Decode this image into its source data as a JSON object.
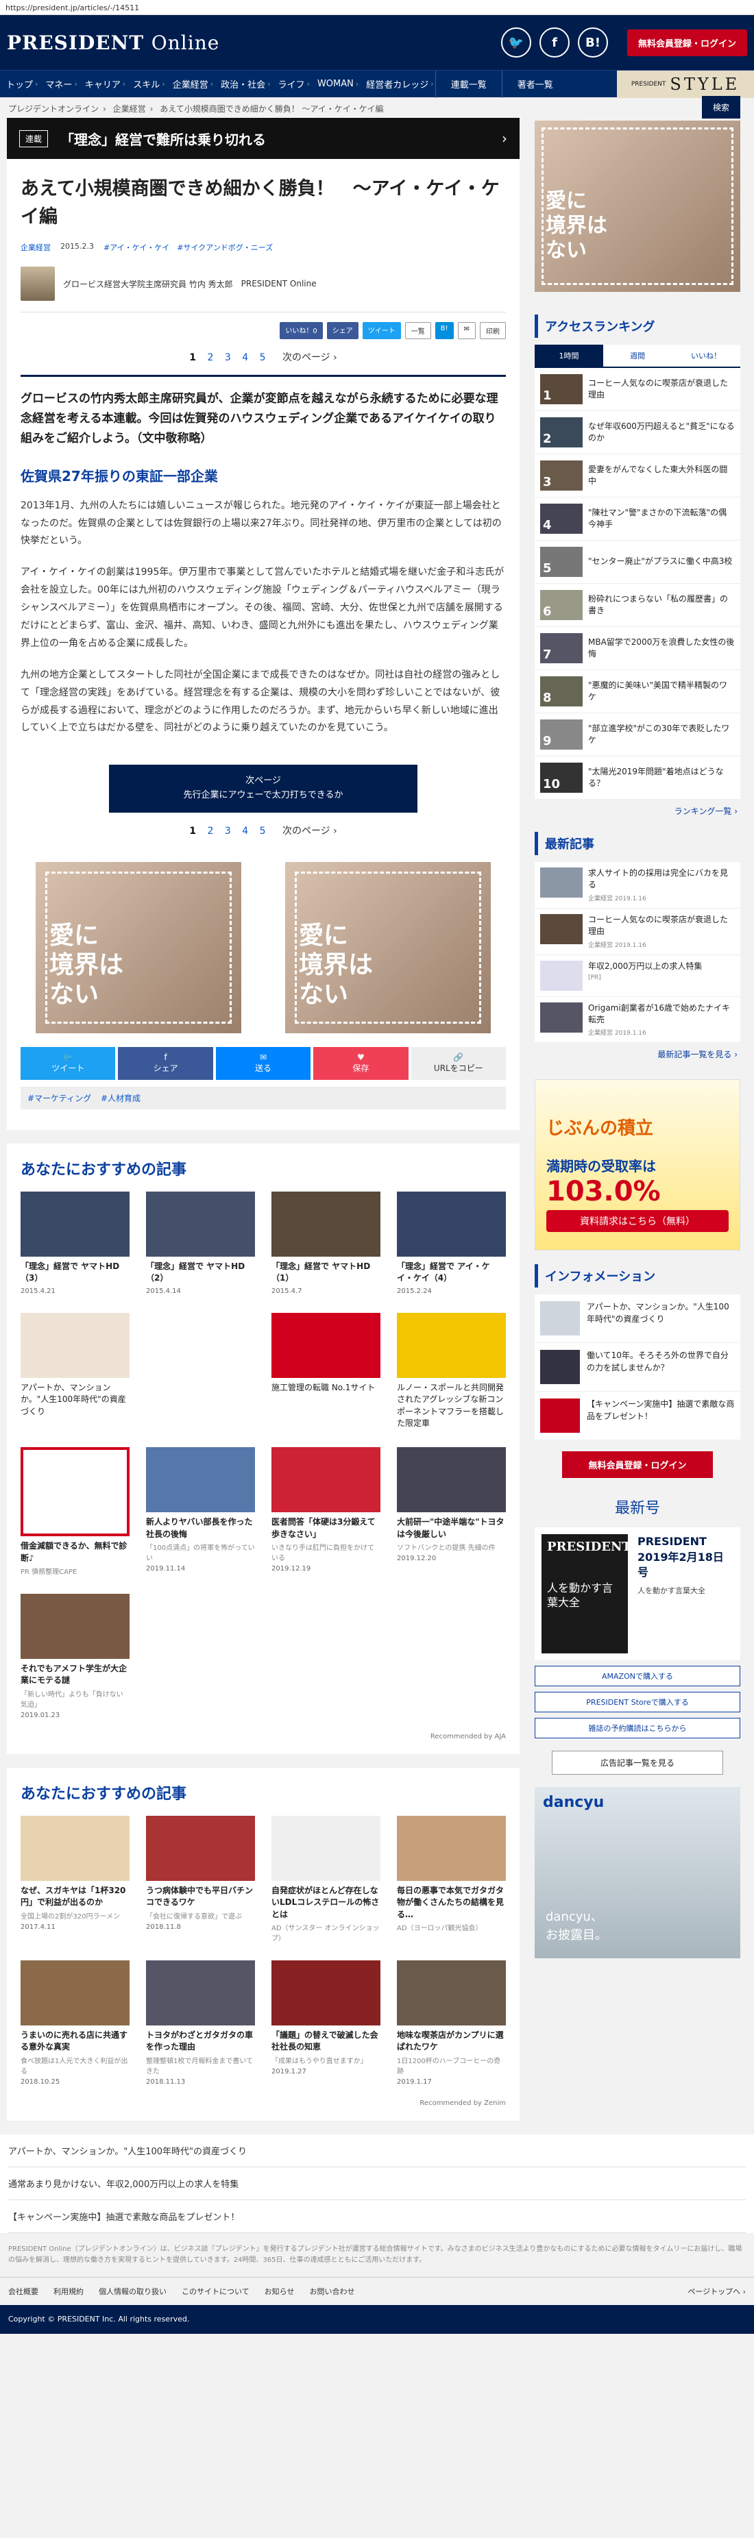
{
  "url": "https://president.jp/articles/-/14511",
  "header": {
    "logo_main": "PRESIDENT",
    "logo_sub": "Online",
    "sns": [
      "twitter",
      "facebook",
      "B!"
    ],
    "register": "無料会員登録・ログイン"
  },
  "nav": {
    "items": [
      "トップ",
      "マネー",
      "キャリア",
      "スキル",
      "企業経営",
      "政治・社会",
      "ライフ",
      "WOMAN",
      "経営者カレッジ"
    ],
    "ext": [
      "連載一覧",
      "著者一覧"
    ],
    "style_small": "PRESIDENT",
    "style_big": "STYLE"
  },
  "breadcrumb": [
    "プレジデントオンライン",
    "企業経営",
    "あえて小規模商圏できめ細かく勝負！ ～アイ・ケイ・ケイ編"
  ],
  "series": {
    "tag": "連載",
    "title": "「理念」経営で難所は乗り切れる"
  },
  "article": {
    "title": "あえて小規模商圏できめ細かく勝負！　～アイ・ケイ・ケイ編",
    "category": "企業経営",
    "date": "2015.2.3",
    "tags_meta": "#アイ・ケイ・ケイ　#サイクアンドボグ・ニーズ",
    "author": "グロービス経営大学院主席研究員 竹内 秀太郎",
    "source": "PRESIDENT Online",
    "share": [
      "いいね！0",
      "シェア",
      "ツイート",
      "一覧",
      "B!",
      "✉",
      "印刷"
    ],
    "pages": [
      "1",
      "2",
      "3",
      "4",
      "5"
    ],
    "next_label": "次のページ ›",
    "lead": "グロービスの竹内秀太郎主席研究員が、企業が変節点を越えながら永続するために必要な理念経営を考える本連載。今回は佐賀発のハウスウェディング企業であるアイケイケイの取り組みをご紹介しよう。（文中敬称略）",
    "h2": "佐賀県27年振りの東証一部企業",
    "p1": "2013年1月、九州の人たちには嬉しいニュースが報じられた。地元発のアイ・ケイ・ケイが東証一部上場会社となったのだ。佐賀県の企業としては佐賀銀行の上場以来27年ぶり。同社発祥の地、伊万里市の企業としては初の快挙だという。",
    "p2": "アイ・ケイ・ケイの創業は1995年。伊万里市で事業として営んでいたホテルと結婚式場を継いだ金子和斗志氏が会社を設立した。00年には九州初のハウスウェディング施設「ウェディング＆パーティハウスベルアミー（現ラシャンスベルアミー）」を佐賀県鳥栖市にオープン。その後、福岡、宮崎、大分、佐世保と九州で店舗を展開するだけにとどまらず、富山、金沢、福井、高知、いわき、盛岡と九州外にも進出を果たし、ハウスウェディング業界上位の一角を占める企業に成長した。",
    "p3": "九州の地方企業としてスタートした同社が全国企業にまで成長できたのはなぜか。同社は自社の経営の強みとして「理念経営の実践」をあげている。経営理念を有する企業は、規模の大小を問わず珍しいことではないが、彼らが成長する過程において、理念がどのように作用したのだろうか。まず、地元からいち早く新しい地域に進出していく上で立ちはだかる壁を、同社がどのように乗り越えていたのかを見ていこう。",
    "nextpage_label": "次ページ",
    "nextpage_sub": "先行企業にアウェーで太刀打ちできるか",
    "ad_text": "愛に\n境界は\nない",
    "share_bar": [
      "ツイート",
      "シェア",
      "送る",
      "保存",
      "URLをコピー"
    ],
    "tags": [
      "#マーケティング",
      "#人材育成"
    ]
  },
  "rec1": {
    "title": "あなたにおすすめの記事",
    "items": [
      {
        "t": "「理念」経営で ヤマトHD（3）",
        "d": "2015.4.21",
        "s": ""
      },
      {
        "t": "「理念」経営で ヤマトHD（2）",
        "d": "2015.4.14",
        "s": ""
      },
      {
        "t": "「理念」経営で ヤマトHD（1）",
        "d": "2015.4.7",
        "s": ""
      },
      {
        "t": "「理念」経営で アイ・ケイ・ケイ（4）",
        "d": "2015.2.24",
        "s": ""
      },
      {
        "t": "アパートか、マンションか。\"人生100年時代\"の資産づくり",
        "d": "",
        "s": ""
      },
      {
        "t": "",
        "d": "",
        "s": ""
      },
      {
        "t": "施工管理の転職 No.1サイト",
        "d": "",
        "s": ""
      },
      {
        "t": "ルノー・スポールと共同開発されたアグレッシブな新コンポーネントマフラーを搭載した限定車",
        "d": "",
        "s": ""
      },
      {
        "t": "借金減額できるか、無料で診断♪",
        "d": "",
        "s": "PR 債務整理CAPE"
      },
      {
        "t": "新人よりヤバい部長を作った社長の後悔",
        "d": "2019.11.14",
        "s": "「100点満点」の将軍を怖がっていい"
      },
      {
        "t": "医者問答「体硬は3分鍛えて歩きなさい」",
        "d": "2019.12.19",
        "s": "いきなり手は肛門に負担をかけている"
      },
      {
        "t": "大前研一\"中途半端な\"トヨタは今後厳しい",
        "d": "2019.12.20",
        "s": "ソフトバンクとの提携 先細の件"
      },
      {
        "t": "それでもアメフト学生が大企業にモテる謎",
        "d": "2019.01.23",
        "s": "「新しい時代」よりも「負けない気迫」"
      }
    ],
    "footer": "Recommended by AJA"
  },
  "rec2": {
    "title": "あなたにおすすめの記事",
    "items": [
      {
        "t": "なぜ、スガキヤは「1杯320円」で利益が出るのか",
        "s": "全国上場の2割が320円ラーメン",
        "d": "2017.4.11"
      },
      {
        "t": "うつ病体験中でも平日バチンコできるワケ",
        "s": "「会社に復帰する意欲」で遊ぶ",
        "d": "2018.11.8"
      },
      {
        "t": "自発症状がほとんど存在しないLDLコレステロールの怖さとは",
        "s": "AD（サンスター オンラインショップ）",
        "d": ""
      },
      {
        "t": "毎日の悪事で本気でガタガタ物が働くさんたちの結構を見る…",
        "s": "AD（ヨーロッパ観光協会）",
        "d": ""
      },
      {
        "t": "うまいのに売れる店に共通する意外な真実",
        "s": "食べ放題は1人元で大きく利益が出る",
        "d": "2018.10.25"
      },
      {
        "t": "トヨタがわざとガタガタの車を作った理由",
        "s": "整理整頓1枚で月報料金まで書いてきた",
        "d": "2018.11.13"
      },
      {
        "t": "「議題」の替えで破滅した会社社長の知恵",
        "s": "「成果はもうやり直せますか」",
        "d": "2019.1.27"
      },
      {
        "t": "地味な喫茶店がカンプリに選ばれたワケ",
        "s": "1日1200杯のハーブコーヒーの奇跡",
        "d": "2019.1.17"
      }
    ],
    "footer": "Recommended by Zenim"
  },
  "sidebar": {
    "ad_text": "愛に\n境界は\nない",
    "search_label": "検索",
    "ranking_title": "アクセスランキング",
    "tabs": [
      "1時間",
      "週間",
      "いいね！"
    ],
    "ranking": [
      "コーヒー人気なのに喫茶店が衰退した理由",
      "なぜ年収600万円超えると\"貧乏\"になるのか",
      "愛妻をがんでなくした東大外科医の闘中",
      "\"陳社マン\"警\"まさかの下流転落\"の偶今神手",
      "\"センター廃止\"がプラスに働く中高3校",
      "粉砕れにつまらない「私の履歴書」の書き",
      "MBA留学で2000万を浪費した女性の後悔",
      "\"悪魔的に美味い\"美国で精半精製のワケ",
      "\"部立進学校\"がこの30年で表貶したワケ",
      "\"太陽光2019年問題\"着地点はどうなる？"
    ],
    "ranking_more": "ランキング一覧 ›",
    "latest_title": "最新記事",
    "latest": [
      {
        "t": "求人サイト的の採用は完全にバカを見る",
        "d": "企業経営 2019.1.16"
      },
      {
        "t": "コーヒー人気なのに喫茶店が衰退した理由",
        "d": "企業経営 2019.1.16"
      },
      {
        "t": "年収2,000万円以上の求人特集",
        "d": "[PR]"
      },
      {
        "t": "Origami創業者が16歳で始めたナイキ転売",
        "d": "企業経営 2019.1.16"
      }
    ],
    "latest_more": "最新記事一覧を見る ›",
    "bank_ad": {
      "l1": "じぶんの積立",
      "l2": "満期時の受取率は",
      "l3": "103.0%",
      "l4": "資料請求はこちら（無料）"
    },
    "info_title": "インフォメーション",
    "info": [
      "アパートか、マンションか。\"人生100年時代\"の資産づくり",
      "働いて10年。そろそろ外の世界で自分の力を試しませんか？",
      "【キャンペーン実施中】抽選で素敵な商品をプレゼント！"
    ],
    "register": "無料会員登録・ログイン",
    "issue_title": "最新号",
    "issue_cover_main": "PRESIDENT",
    "issue_cover_sub": "人を動かす言葉大全",
    "issue_name": "PRESIDENT 2019年2月18日号",
    "issue_topic": "人を動かす言葉大全",
    "buy": [
      "AMAZONで購入する",
      "PRESIDENT Storeで購入する",
      "雑誌の予約購読はこちらから"
    ],
    "adlist": "広告記事一覧を見る",
    "dancyu_logo": "dancyu",
    "dancyu_copy": "dancyu、\nお披露目。"
  },
  "bottom": {
    "links": [
      "アパートか、マンションか。\"人生100年時代\"の資産づくり",
      "通常あまり見かけない、年収2,000万円以上の求人を特集",
      "【キャンペーン実施中】抽選で素敵な商品をプレゼント！"
    ],
    "disclaimer": "PRESIDENT Online（プレジデントオンライン）は、ビジネス誌『プレジデント』を発行するプレジデント社が運営する総合情報サイトです。みなさまのビジネス生活より豊かなものにするために必要な情報をタイムリーにお届けし、職場の悩みを解消し、理想的な働き方を実現するヒントを提供していきます。24時間、365日、仕事の達成感とともにご活用いただけます。",
    "footnav": [
      "会社概要",
      "利用規約",
      "個人情報の取り扱い",
      "このサイトについて",
      "お知らせ",
      "お問い合わせ"
    ],
    "pagetop": "ページトップへ ›",
    "copyright": "Copyright © PRESIDENT Inc. All rights reserved."
  }
}
